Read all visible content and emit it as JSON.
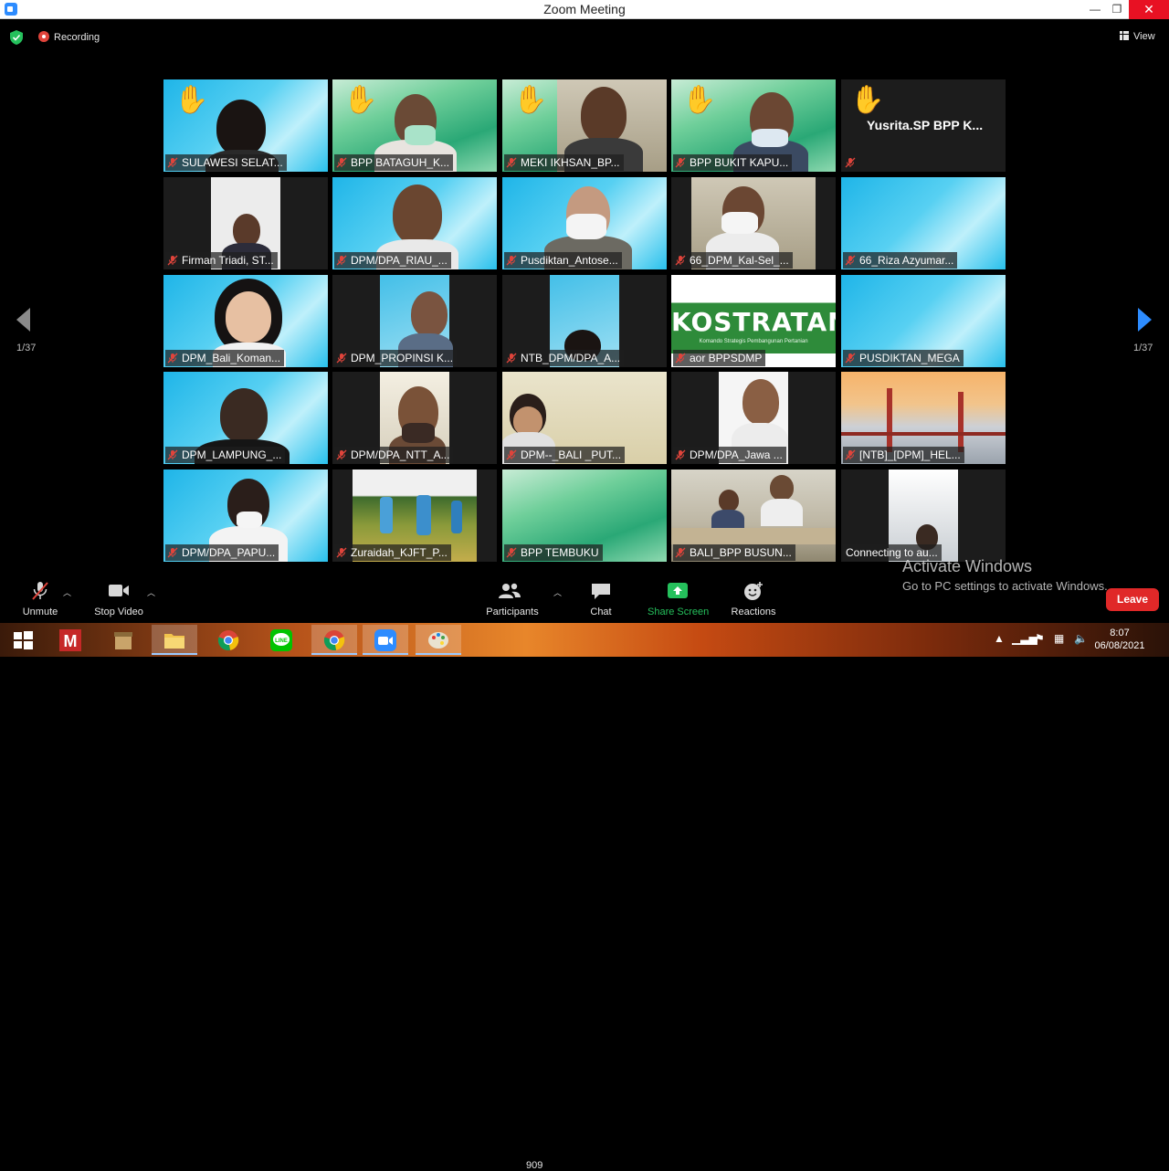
{
  "window": {
    "title": "Zoom Meeting",
    "minimize": "—",
    "maximize": "❐",
    "close": "✕"
  },
  "topbar": {
    "recording": "Recording",
    "view": "View"
  },
  "pagination": {
    "left": "1/37",
    "right": "1/37"
  },
  "tiles": [
    {
      "name": "SULAWESI SELAT...",
      "hand": true
    },
    {
      "name": "BPP BATAGUH_K...",
      "hand": true
    },
    {
      "name": "MEKI IKHSAN_BP...",
      "hand": true
    },
    {
      "name": "BPP BUKIT KAPU...",
      "hand": true
    },
    {
      "name": "Yusrita.SP BPP K...",
      "hand": true
    },
    {
      "name": "Firman Triadi, ST..."
    },
    {
      "name": "DPM/DPA_RIAU_..."
    },
    {
      "name": "Pusdiktan_Antose..."
    },
    {
      "name": "66_DPM_Kal-Sel_..."
    },
    {
      "name": "66_Riza Azyumar..."
    },
    {
      "name": "DPM_Bali_Koman..."
    },
    {
      "name": "DPM_PROPINSI K..."
    },
    {
      "name": "NTB_DPM/DPA_A..."
    },
    {
      "name": "aor BPPSDMP"
    },
    {
      "name": "PUSDIKTAN_MEGA"
    },
    {
      "name": "DPM_LAMPUNG_..."
    },
    {
      "name": "DPM/DPA_NTT_A..."
    },
    {
      "name": "DPM--_BALI _PUT..."
    },
    {
      "name": "DPM/DPA_Jawa ..."
    },
    {
      "name": "[NTB]_[DPM]_HEL..."
    },
    {
      "name": "DPM/DPA_PAPU..."
    },
    {
      "name": "Zuraidah_KJFT_P..."
    },
    {
      "name": "BPP TEMBUKU"
    },
    {
      "name": "BALI_BPP BUSUN..."
    },
    {
      "name": "Connecting to au..."
    }
  ],
  "kostratani": {
    "title": "KOSTRATANI",
    "subtitle": "Komando Strategis Pembangunan Pertanian"
  },
  "watermark": {
    "line1": "Activate Windows",
    "line2": "Go to PC settings to activate Windows."
  },
  "toolbar": {
    "unmute": "Unmute",
    "stop_video": "Stop Video",
    "participants": "Participants",
    "participants_count": "909",
    "chat": "Chat",
    "share_screen": "Share Screen",
    "reactions": "Reactions",
    "leave": "Leave"
  },
  "taskbar": {
    "time": "8:07",
    "date": "06/08/2021"
  },
  "colors": {
    "accent": "#2d8cff",
    "leave": "#e02828",
    "share": "#25c05c",
    "mic_off": "#e0443b"
  }
}
